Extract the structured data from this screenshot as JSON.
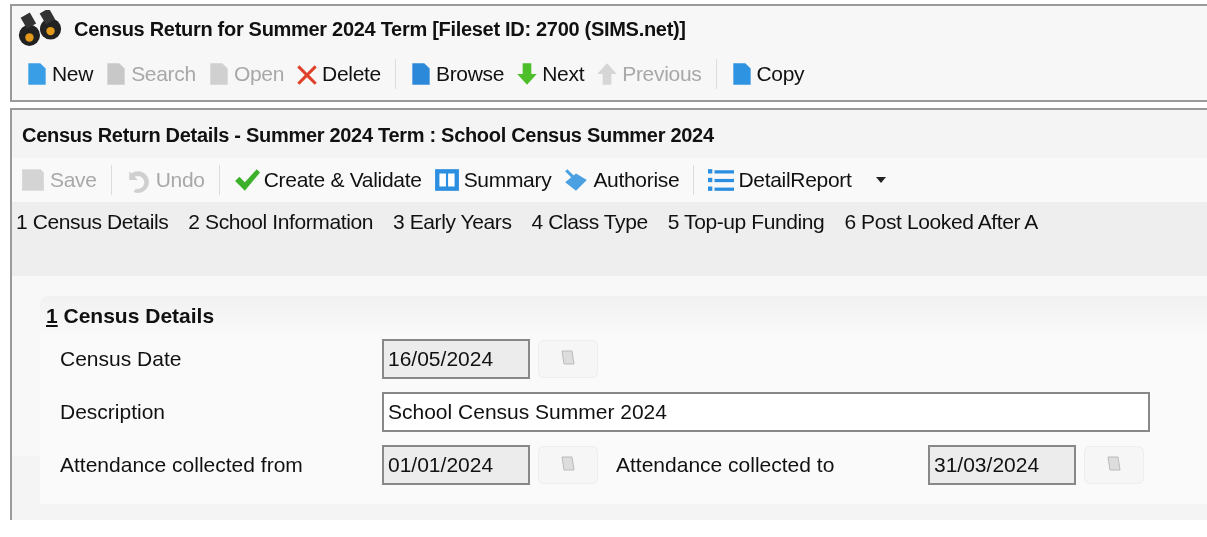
{
  "window": {
    "title": "Census Return for Summer 2024 Term [Fileset ID: 2700 (SIMS.net)]"
  },
  "toolbar": [
    {
      "kind": "new",
      "label": "New",
      "disabled": false
    },
    {
      "kind": "search",
      "label": "Search",
      "disabled": true
    },
    {
      "kind": "open",
      "label": "Open",
      "disabled": true
    },
    {
      "kind": "delete",
      "label": "Delete",
      "disabled": false
    },
    {
      "kind": "sep"
    },
    {
      "kind": "browse",
      "label": "Browse",
      "disabled": false
    },
    {
      "kind": "next",
      "label": "Next",
      "disabled": false
    },
    {
      "kind": "previous",
      "label": "Previous",
      "disabled": true
    },
    {
      "kind": "sep"
    },
    {
      "kind": "copy",
      "label": "Copy",
      "disabled": false
    }
  ],
  "details": {
    "title": "Census Return Details - Summer 2024 Term : School Census Summer 2024",
    "toolbar": [
      {
        "kind": "save",
        "label": "Save",
        "disabled": true
      },
      {
        "kind": "sep"
      },
      {
        "kind": "undo",
        "label": "Undo",
        "disabled": true
      },
      {
        "kind": "sep"
      },
      {
        "kind": "validate",
        "label": "Create & Validate",
        "disabled": false
      },
      {
        "kind": "summary",
        "label": "Summary",
        "disabled": false
      },
      {
        "kind": "authorise",
        "label": "Authorise",
        "disabled": false
      },
      {
        "kind": "sep"
      },
      {
        "kind": "report",
        "label": "DetailReport",
        "disabled": false
      }
    ],
    "tabs": [
      "1 Census Details",
      "2 School Information",
      "3 Early Years",
      "4 Class Type",
      "5 Top-up Funding",
      "6 Post Looked After A"
    ],
    "section": {
      "number": "1",
      "title": "Census Details",
      "fields": [
        {
          "label": "Census Date",
          "value": "16/05/2024",
          "kind": "date",
          "readonly": true
        },
        {
          "label": "Description",
          "value": "School Census Summer 2024",
          "kind": "text",
          "readonly": false
        },
        {
          "label": "Attendance collected from",
          "value": "01/01/2024",
          "kind": "date",
          "readonly": true,
          "pair": {
            "label": "Attendance collected to",
            "value": "31/03/2024",
            "readonly": true
          }
        }
      ]
    }
  }
}
